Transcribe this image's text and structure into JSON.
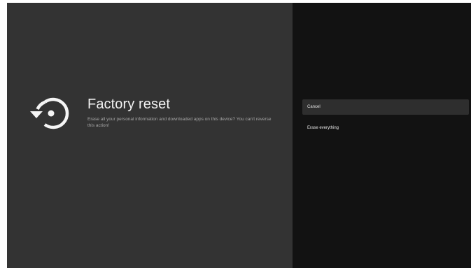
{
  "page": {
    "title": "Factory reset",
    "description": "Erase all your personal information and downloaded apps on this device? You can't reverse this action!",
    "icon": "restore-icon"
  },
  "colors": {
    "left_panel": "#333333",
    "right_panel": "#121212",
    "selected_item": "#2e2e2e",
    "title_text": "#f2f2f2",
    "description_text": "#a6a6a6"
  },
  "options": {
    "items": [
      {
        "label": "Cancel",
        "selected": true
      },
      {
        "label": "Erase everything",
        "selected": false
      }
    ]
  }
}
